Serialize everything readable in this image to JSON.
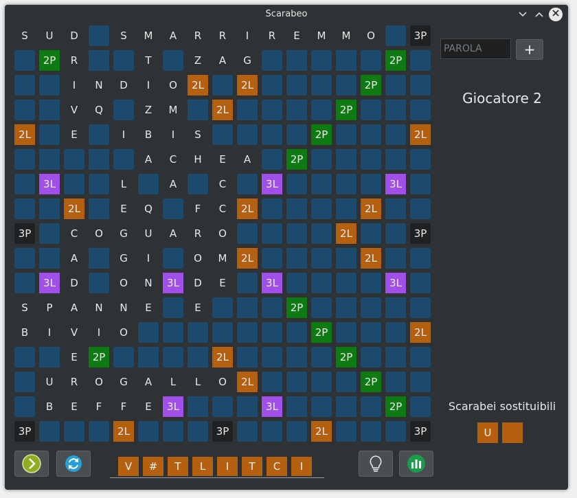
{
  "window": {
    "title": "Scarabeo"
  },
  "titlebar": {
    "minimize_glyph": "⌵",
    "maximize_glyph": "︿",
    "close_glyph": "✕"
  },
  "board": {
    "size": 17,
    "rows": [
      [
        "S",
        "U",
        "D",
        "#blue",
        "S",
        "M",
        "A",
        "R",
        "R",
        "I",
        "R",
        "E",
        "M",
        "M",
        "O",
        "#blue",
        "#3P"
      ],
      [
        "#blue",
        "#2P",
        "R",
        "#blue",
        "#blue",
        "T",
        "#blue",
        "Z",
        "A",
        "G",
        "#blue",
        "#blue",
        "#blue",
        "#blue",
        "#blue",
        "#2P",
        "#blue"
      ],
      [
        "#blue",
        "#blue",
        "I",
        "N",
        "D",
        "I",
        "O",
        "#2L",
        "#blue",
        "#2L",
        "#blue",
        "#blue",
        "#blue",
        "#blue",
        "#2P",
        "#blue",
        "#blue"
      ],
      [
        "#blue",
        "#blue",
        "V",
        "Q",
        "#blue",
        "Z",
        "M",
        "#blue",
        "#2L",
        "#blue",
        "#blue",
        "#blue",
        "#blue",
        "#2P",
        "#blue",
        "#blue",
        "#blue"
      ],
      [
        "#2L",
        "#blue",
        "E",
        "#blue",
        "I",
        "B",
        "I",
        "S",
        "#blue",
        "#blue",
        "#blue",
        "#blue",
        "#2P",
        "#blue",
        "#blue",
        "#blue",
        "#2L"
      ],
      [
        "#blue",
        "#blue",
        "#blue",
        "#blue",
        "#blue",
        "A",
        "C",
        "H",
        "E",
        "A",
        "#blue",
        "#2P",
        "#blue",
        "#blue",
        "#blue",
        "#blue",
        "#blue"
      ],
      [
        "#blue",
        "#3L",
        "#blue",
        "#blue",
        "L",
        "#blue",
        "A",
        "#blue",
        "C",
        "#blue",
        "#3L",
        "#blue",
        "#blue",
        "#blue",
        "#blue",
        "#3L",
        "#blue"
      ],
      [
        "#blue",
        "#blue",
        "#2L",
        "#blue",
        "E",
        "Q",
        "#blue",
        "F",
        "C",
        "#2L",
        "#blue",
        "#blue",
        "#blue",
        "#blue",
        "#2L",
        "#blue",
        "#blue"
      ],
      [
        "#3P",
        "#blue",
        "C",
        "O",
        "G",
        "U",
        "A",
        "R",
        "O",
        "#blue",
        "#blue",
        "#blue",
        "#blue",
        "#2L",
        "#blue",
        "#blue",
        "#3P"
      ],
      [
        "#blue",
        "#blue",
        "A",
        "#blue",
        "G",
        "I",
        "#blue",
        "O",
        "M",
        "#2L",
        "#blue",
        "#blue",
        "#blue",
        "#blue",
        "#2L",
        "#blue",
        "#blue"
      ],
      [
        "#blue",
        "#3L",
        "D",
        "#blue",
        "O",
        "N",
        "#3L",
        "D",
        "E",
        "#blue",
        "#3L",
        "#blue",
        "#blue",
        "#blue",
        "#blue",
        "#3L",
        "#blue"
      ],
      [
        "S",
        "P",
        "A",
        "N",
        "N",
        "E",
        "#blue",
        "E",
        "#blue",
        "#blue",
        "#blue",
        "#2P",
        "#blue",
        "#blue",
        "#blue",
        "#blue",
        "#blue"
      ],
      [
        "B",
        "I",
        "V",
        "I",
        "O",
        "#blue",
        "#blue",
        "#blue",
        "#blue",
        "#blue",
        "#blue",
        "#blue",
        "#2P",
        "#blue",
        "#blue",
        "#blue",
        "#2L"
      ],
      [
        "#blue",
        "#blue",
        "E",
        "#2P",
        "#blue",
        "#blue",
        "#blue",
        "#blue",
        "#2L",
        "#blue",
        "#blue",
        "#blue",
        "#blue",
        "#2P",
        "#blue",
        "#blue",
        "#blue"
      ],
      [
        "#blue",
        "U",
        "R",
        "O",
        "G",
        "A",
        "L",
        "L",
        "O",
        "#2L",
        "#blue",
        "#blue",
        "#blue",
        "#blue",
        "#2P",
        "#blue",
        "#blue"
      ],
      [
        "#blue",
        "B",
        "E",
        "F",
        "F",
        "E",
        "#3L",
        "#blue",
        "#blue",
        "#blue",
        "#3L",
        "#blue",
        "#blue",
        "#blue",
        "#blue",
        "#2P",
        "#blue"
      ],
      [
        "#3P",
        "#blue",
        "#blue",
        "#blue",
        "#2L",
        "#blue",
        "#blue",
        "#blue",
        "#3P",
        "#blue",
        "#blue",
        "#blue",
        "#2L",
        "#blue",
        "#blue",
        "#blue",
        "#3P"
      ]
    ]
  },
  "sidebar": {
    "word_input_placeholder": "PAROLA",
    "add_button_label": "+",
    "current_player": "Giocatore 2",
    "substitutable_label": "Scarabei sostituibili",
    "substitutable_tiles": [
      "U",
      ""
    ]
  },
  "rack": {
    "tiles": [
      "V",
      "#",
      "T",
      "L",
      "I",
      "T",
      "C",
      "I"
    ]
  },
  "toolbar": {
    "next_icon": "chevron-right-icon",
    "swap_icon": "refresh-icon",
    "hint_icon": "lightbulb-icon",
    "stats_icon": "bar-chart-icon"
  },
  "colors": {
    "window_bg": "#2f3234",
    "empty_cell": "#1b4a6d",
    "double_letter": "#b5600f",
    "triple_letter": "#a050e8",
    "double_word": "#0e7a12",
    "triple_word": "#1f2122",
    "rack_tile": "#b5600f"
  }
}
